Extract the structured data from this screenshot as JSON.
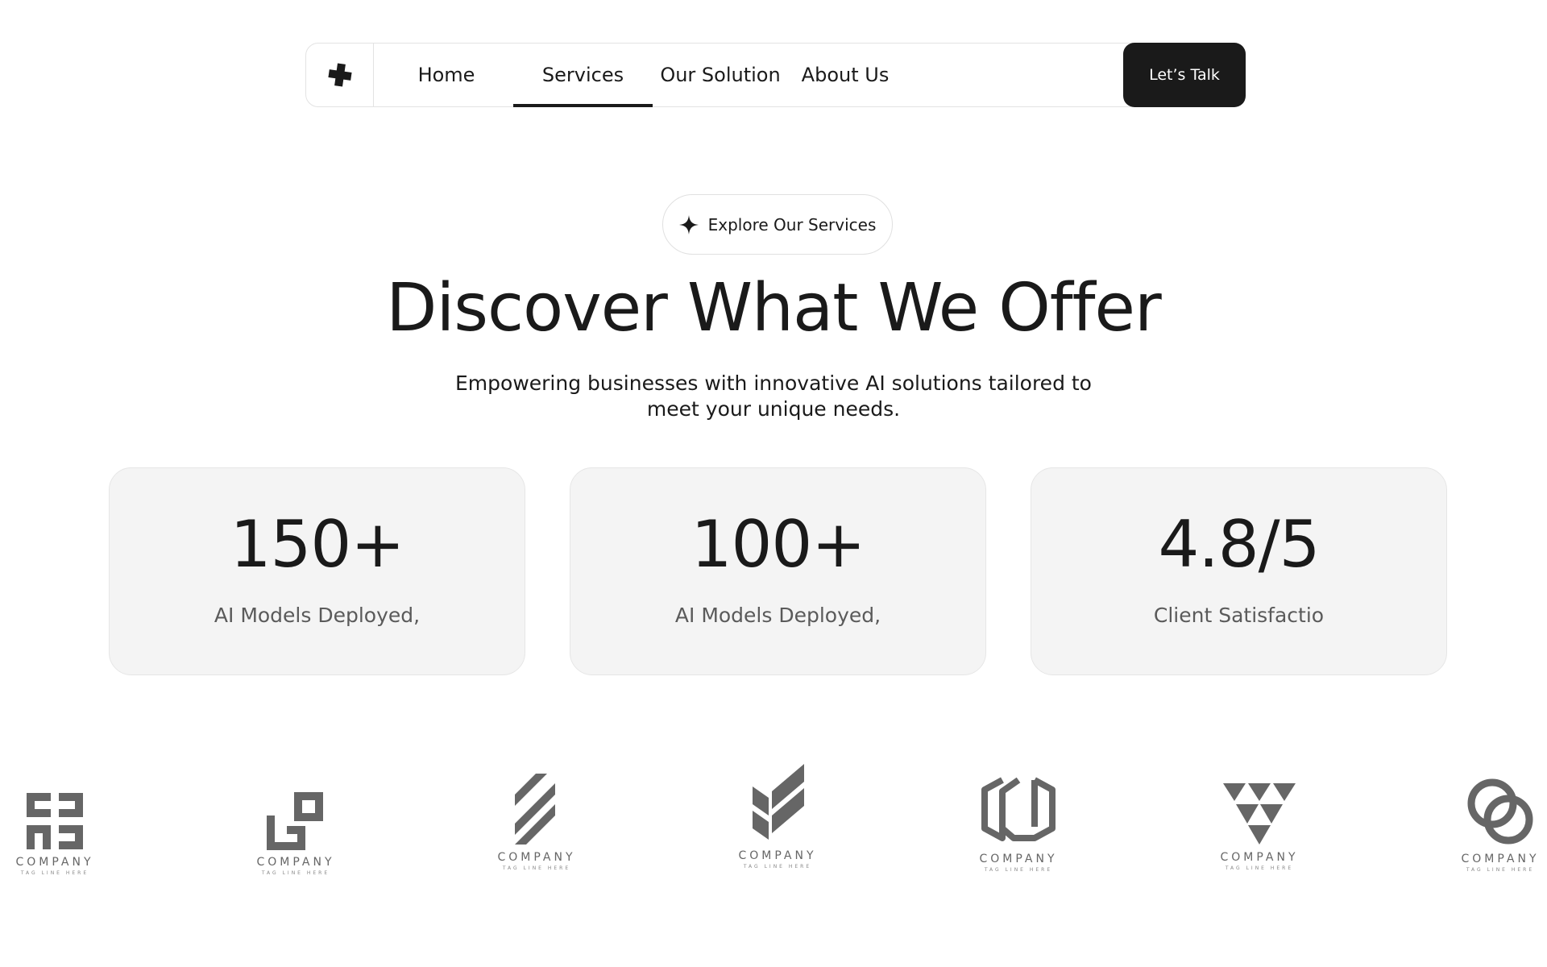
{
  "nav": {
    "logo_icon": "plus-icon",
    "items": [
      {
        "label": "Home",
        "active": false
      },
      {
        "label": "Services",
        "active": true
      },
      {
        "label": "Our Solution",
        "active": false
      },
      {
        "label": "About Us",
        "active": false
      }
    ],
    "cta_label": "Let’s Talk"
  },
  "hero": {
    "pill_icon": "sparkle-icon",
    "pill_label": "Explore Our Services",
    "title": "Discover What We Offer",
    "subtitle": "Empowering businesses with innovative AI solutions tailored to meet your unique needs."
  },
  "stats": [
    {
      "value": "150+",
      "label": "AI Models Deployed,"
    },
    {
      "value": "100+",
      "label": "AI Models Deployed,"
    },
    {
      "value": "4.8/5",
      "label": "Client Satisfactio"
    }
  ],
  "logos": [
    {
      "icon": "square-knot-logo-icon",
      "name": "COMPANY",
      "tagline": "TAG LINE HERE"
    },
    {
      "icon": "linked-squares-logo-icon",
      "name": "COMPANY",
      "tagline": "TAG LINE HERE"
    },
    {
      "icon": "diagonal-stripes-logo-icon",
      "name": "COMPANY",
      "tagline": "TAG LINE HERE"
    },
    {
      "icon": "chevron-shield-logo-icon",
      "name": "COMPANY",
      "tagline": "TAG LINE HERE"
    },
    {
      "icon": "hexagon-loop-logo-icon",
      "name": "COMPANY",
      "tagline": "TAG LINE HERE"
    },
    {
      "icon": "triangles-logo-icon",
      "name": "COMPANY",
      "tagline": "TAG LINE HERE"
    },
    {
      "icon": "rings-logo-icon",
      "name": "COMPANY",
      "tagline": "TAG LINE HERE"
    }
  ],
  "colors": {
    "primary": "#1a1a1a",
    "card_bg": "#f4f4f4",
    "muted_text": "#5a5a5a",
    "logo_gray": "#666666"
  }
}
